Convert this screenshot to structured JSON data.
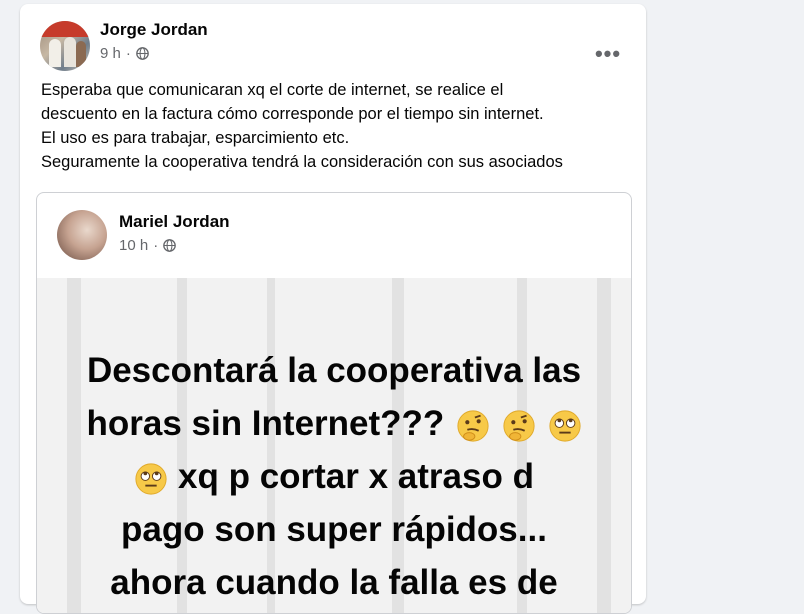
{
  "post": {
    "author": "Jorge Jordan",
    "time": "9 h",
    "more_label": "•••",
    "text_lines": [
      "Esperaba que comunicaran xq el corte de internet, se realice el",
      "descuento en la factura cómo corresponde por el tiempo sin internet.",
      "El uso es para trabajar, esparcimiento etc.",
      "Seguramente la cooperativa tendrá la consideración con sus asociados"
    ],
    "privacy_icon": "globe-icon"
  },
  "shared": {
    "author": "Mariel Jordan",
    "time": "10 h",
    "privacy_icon": "globe-icon",
    "story": {
      "line1": "Descontará la cooperativa las",
      "line2": "horas sin Internet???",
      "line2_emojis": [
        "thinking-face",
        "thinking-face",
        "face-with-rolling-eyes"
      ],
      "line3_emoji": "face-with-rolling-eyes",
      "line3": "xq p cortar x atraso d",
      "line4": "pago son super rápidos...",
      "line5": "ahora cuando la falla es de"
    }
  }
}
